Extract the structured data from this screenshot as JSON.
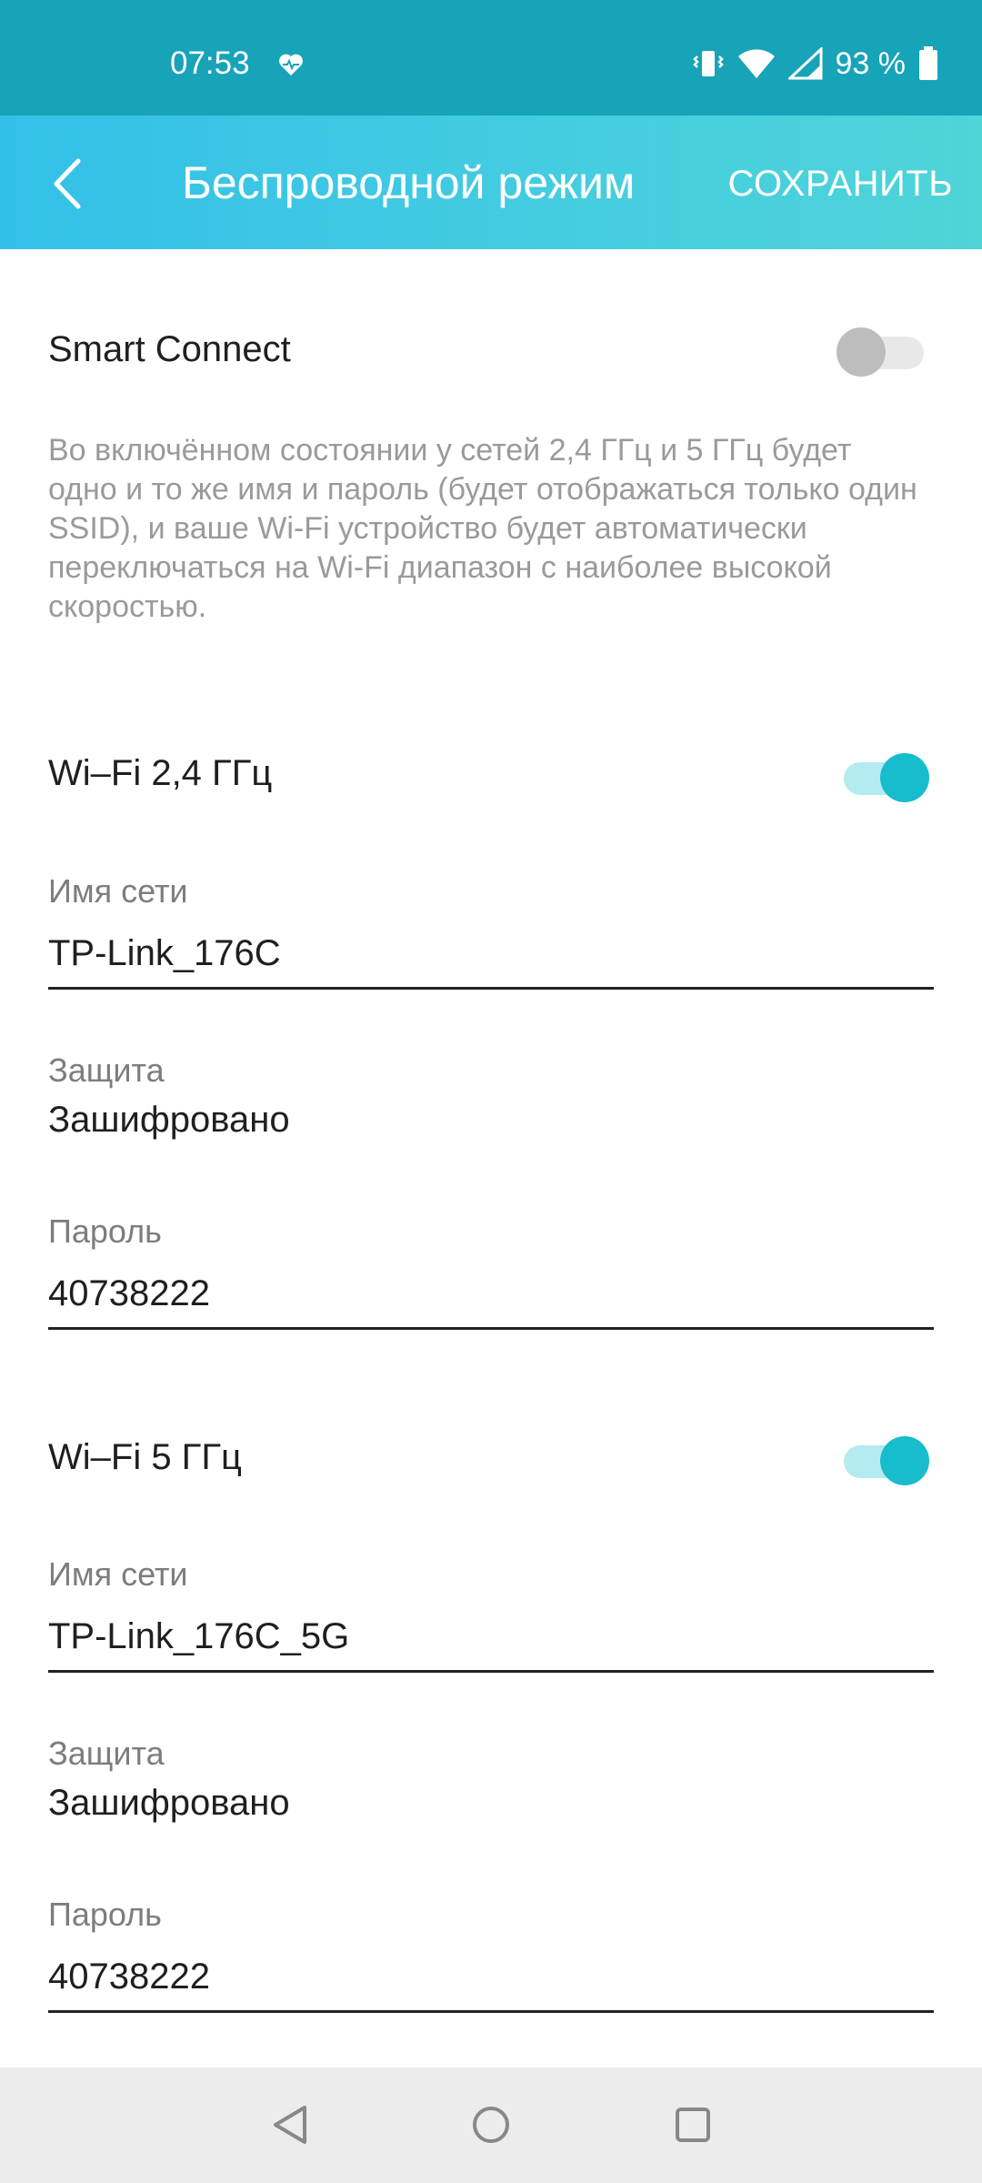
{
  "status_bar": {
    "time": "07:53",
    "battery": "93 %",
    "icons": [
      "heart-monitor-icon",
      "vibrate-icon",
      "wifi-icon",
      "signal-icon",
      "battery-icon"
    ]
  },
  "app_bar": {
    "title": "Беспроводной режим",
    "save_label": "СОХРАНИТЬ",
    "back_icon": "chevron-left-icon"
  },
  "smart_connect": {
    "label": "Smart Connect",
    "enabled": false,
    "description": "Во включённом состоянии у сетей 2,4 ГГц и 5 ГГц будет одно и то же имя и пароль (будет отображаться только один SSID), и ваше Wi-Fi устройство будет автоматически переключаться на Wi-Fi диапазон с наиболее высокой скоростью."
  },
  "wifi_24": {
    "label": "Wi–Fi 2,4 ГГц",
    "enabled": true,
    "ssid_label": "Имя сети",
    "ssid": "TP-Link_176C",
    "security_label": "Защита",
    "security": "Зашифровано",
    "password_label": "Пароль",
    "password": "40738222"
  },
  "wifi_5": {
    "label": "Wi–Fi 5 ГГц",
    "enabled": true,
    "ssid_label": "Имя сети",
    "ssid": "TP-Link_176C_5G",
    "security_label": "Защита",
    "security": "Зашифровано",
    "password_label": "Пароль",
    "password": "40738222"
  },
  "colors": {
    "status_bar": "#17a3b8",
    "app_bar_start": "#33c0e8",
    "app_bar_end": "#4fd4d8",
    "toggle_on": "#17bccd",
    "toggle_off": "#bdbdbd"
  },
  "nav_bar": {
    "icons": [
      "back-triangle-icon",
      "home-circle-icon",
      "recents-square-icon"
    ]
  }
}
